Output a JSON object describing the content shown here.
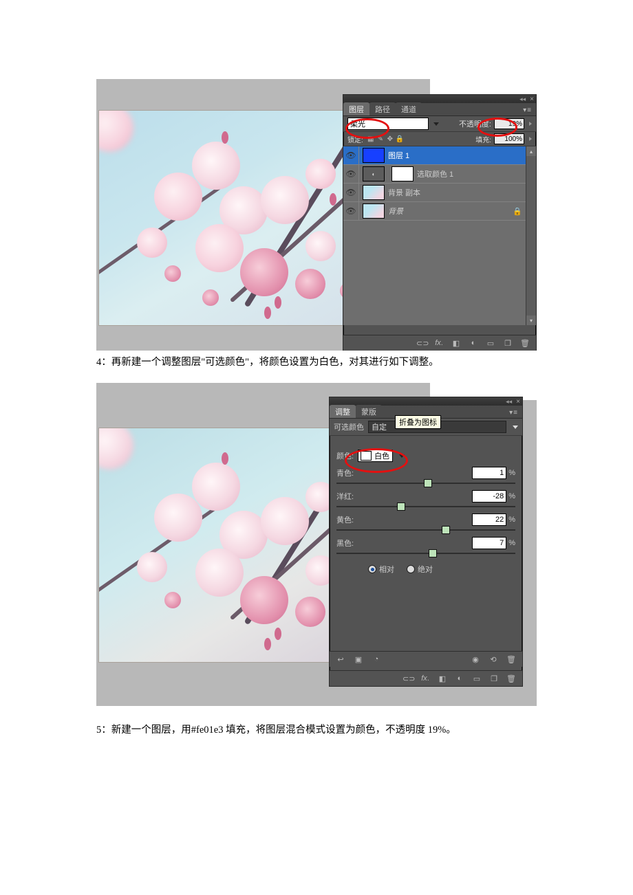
{
  "fig1": {
    "panel_tabs": [
      "图层",
      "路径",
      "通道"
    ],
    "blend_mode": "柔光",
    "opacity_label": "不透明度:",
    "opacity_value": "19%",
    "lock_label": "锁定:",
    "fill_label": "填充:",
    "fill_value": "100%",
    "layers": [
      {
        "name": "图层 1",
        "thumb": "blue",
        "selected": true
      },
      {
        "name": "选取颜色 1",
        "thumb": "adj",
        "has_mask": true
      },
      {
        "name": "背景 副本",
        "thumb": "photo"
      },
      {
        "name": "背景",
        "thumb": "photo",
        "locked": true,
        "italic": true
      }
    ]
  },
  "caption4": "4：再新建一个调整图层\"可选颜色\"，将颜色设置为白色，对其进行如下调整。",
  "fig2": {
    "panel_tabs": [
      "调整",
      "蒙版"
    ],
    "tooltip": "折叠为图标",
    "adjust_name": "可选颜色",
    "preset": "自定",
    "color_label": "颜色:",
    "color_value": "白色",
    "sliders": [
      {
        "label": "青色:",
        "value": "1",
        "pos": 51
      },
      {
        "label": "洋红:",
        "value": "-28",
        "pos": 36
      },
      {
        "label": "黄色:",
        "value": "22",
        "pos": 61
      },
      {
        "label": "黑色:",
        "value": "7",
        "pos": 54
      }
    ],
    "relative": "相对",
    "absolute": "绝对",
    "pct": "%"
  },
  "caption5": "5：新建一个图层，用#fe01e3 填充，将图层混合模式设置为颜色，不透明度 19%。"
}
